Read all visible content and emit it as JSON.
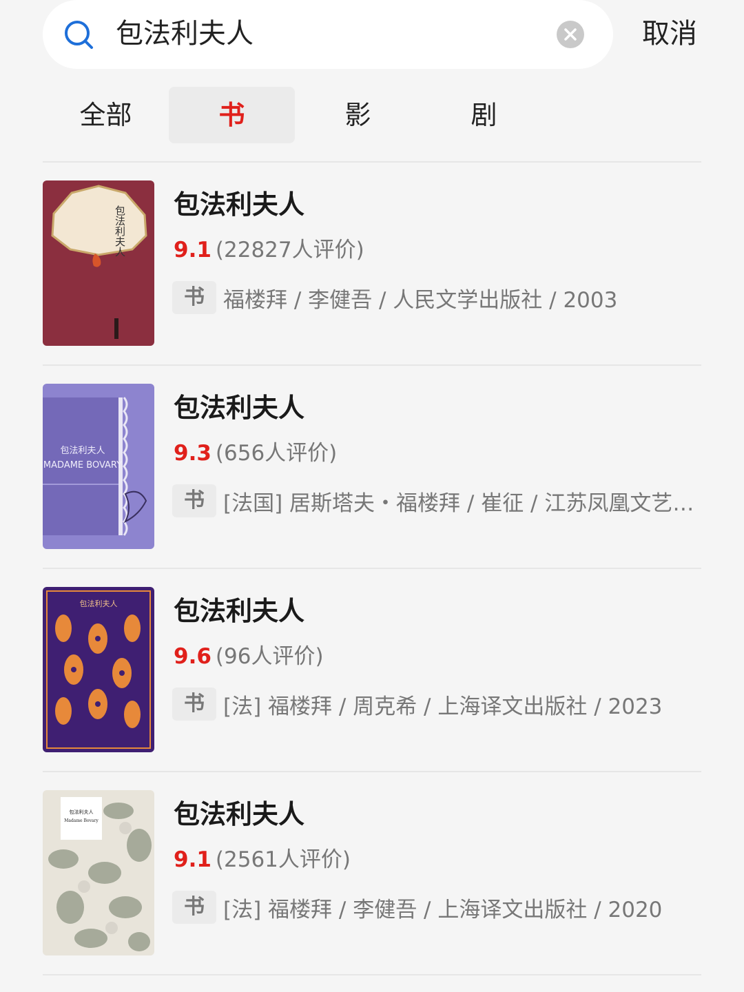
{
  "search": {
    "query": "包法利夫人",
    "cancel_label": "取消"
  },
  "tabs": [
    {
      "label": "全部",
      "active": false
    },
    {
      "label": "书",
      "active": true
    },
    {
      "label": "影",
      "active": false
    },
    {
      "label": "剧",
      "active": false
    }
  ],
  "colors": {
    "accent": "#e0201b",
    "badge_bg": "#ebebeb",
    "background": "#f5f5f5"
  },
  "results": [
    {
      "title": "包法利夫人",
      "score": "9.1",
      "votes": "(22827人评价)",
      "badge": "书",
      "meta": "福楼拜 / 李健吾 / 人民文学出版社 / 2003",
      "cover": {
        "color": "#8b2f3f",
        "title_text": "包法利夫人"
      }
    },
    {
      "title": "包法利夫人",
      "score": "9.3",
      "votes": "(656人评价)",
      "badge": "书",
      "meta": "[法国] 居斯塔夫・福楼拜 / 崔征 / 江苏凤凰文艺…",
      "cover": {
        "color": "#8d84cf",
        "title_text": "包法利夫人",
        "subtitle": "MADAME BOVARY"
      }
    },
    {
      "title": "包法利夫人",
      "score": "9.6",
      "votes": "(96人评价)",
      "badge": "书",
      "meta": "[法] 福楼拜 / 周克希 / 上海译文出版社 / 2023",
      "cover": {
        "color": "#3f1f72",
        "title_text": "包法利夫人"
      }
    },
    {
      "title": "包法利夫人",
      "score": "9.1",
      "votes": "(2561人评价)",
      "badge": "书",
      "meta": "[法] 福楼拜 / 李健吾 / 上海译文出版社 / 2020",
      "cover": {
        "color": "#e8e4da",
        "title_text": "包法利夫人",
        "subtitle": "Madame Bovary"
      }
    }
  ]
}
